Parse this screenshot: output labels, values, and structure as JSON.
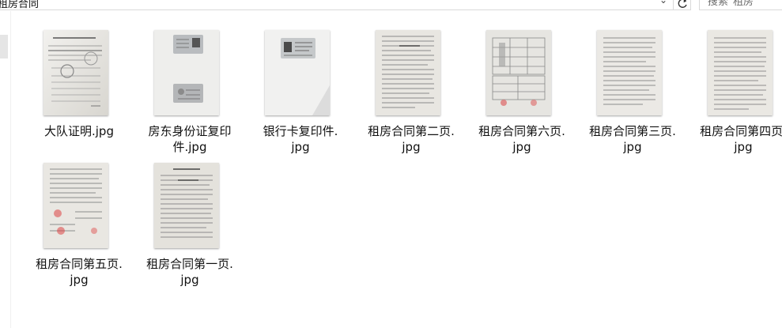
{
  "address_bar": {
    "path": "租房合同"
  },
  "search": {
    "placeholder": "搜索\"租房\""
  },
  "icons": {
    "dropdown": "chevron-down-icon",
    "refresh": "refresh-icon"
  },
  "files": [
    {
      "line1": "大队证明.jpg",
      "line2": ""
    },
    {
      "line1": "房东身份证复印",
      "line2": "件.jpg"
    },
    {
      "line1": "银行卡复印件.",
      "line2": "jpg"
    },
    {
      "line1": "租房合同第二页.",
      "line2": "jpg"
    },
    {
      "line1": "租房合同第六页.",
      "line2": "jpg"
    },
    {
      "line1": "租房合同第三页.",
      "line2": "jpg"
    },
    {
      "line1": "租房合同第四页.",
      "line2": "jpg"
    },
    {
      "line1": "租房合同第五页.",
      "line2": "jpg"
    },
    {
      "line1": "租房合同第一页.",
      "line2": "jpg"
    }
  ]
}
